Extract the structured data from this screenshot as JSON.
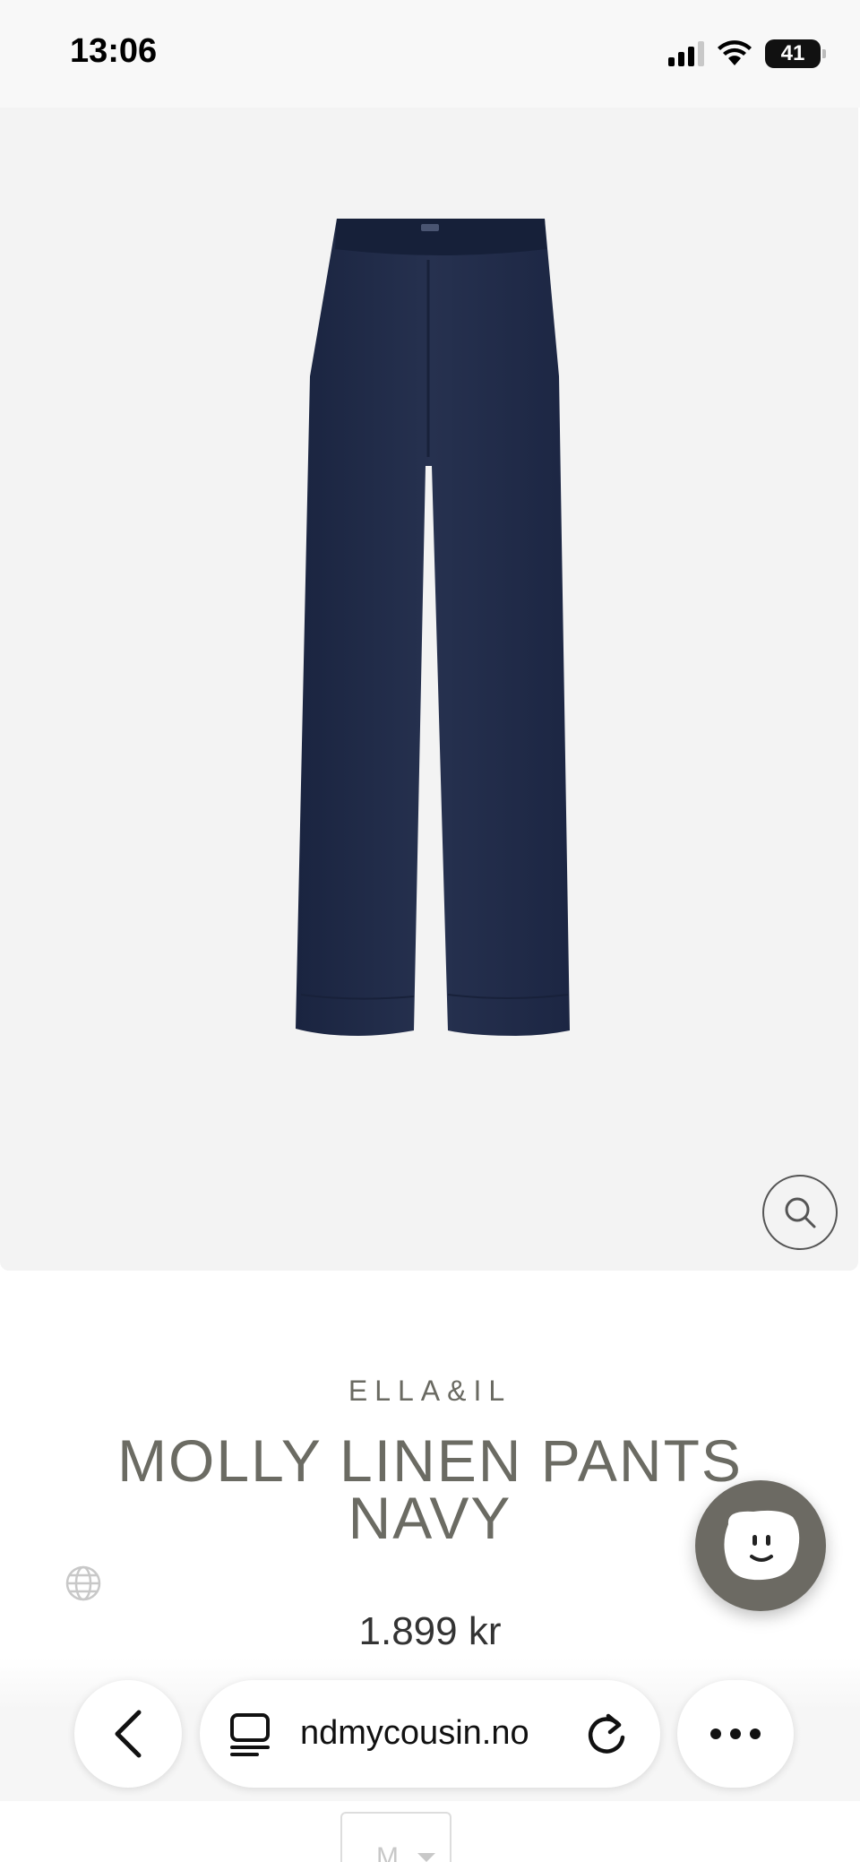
{
  "status": {
    "time": "13:06",
    "battery": "41",
    "signal_bars": 4,
    "signal_bars_active": 3
  },
  "product": {
    "brand": "ELLA&IL",
    "title": "MOLLY LINEN PANTS NAVY",
    "price": "1.899 kr",
    "selected_size": "M",
    "image_alt": "navy linen wide-leg pants",
    "pants_color": "#1f2a44"
  },
  "browser": {
    "url": "ndmycousin.no"
  },
  "icons": {
    "zoom": "magnifier-icon",
    "globe": "globe-icon",
    "chat": "chat-face-icon",
    "back": "chevron-left-icon",
    "tabs": "tabs-icon",
    "reload": "reload-icon",
    "more": "more-dots-icon"
  }
}
